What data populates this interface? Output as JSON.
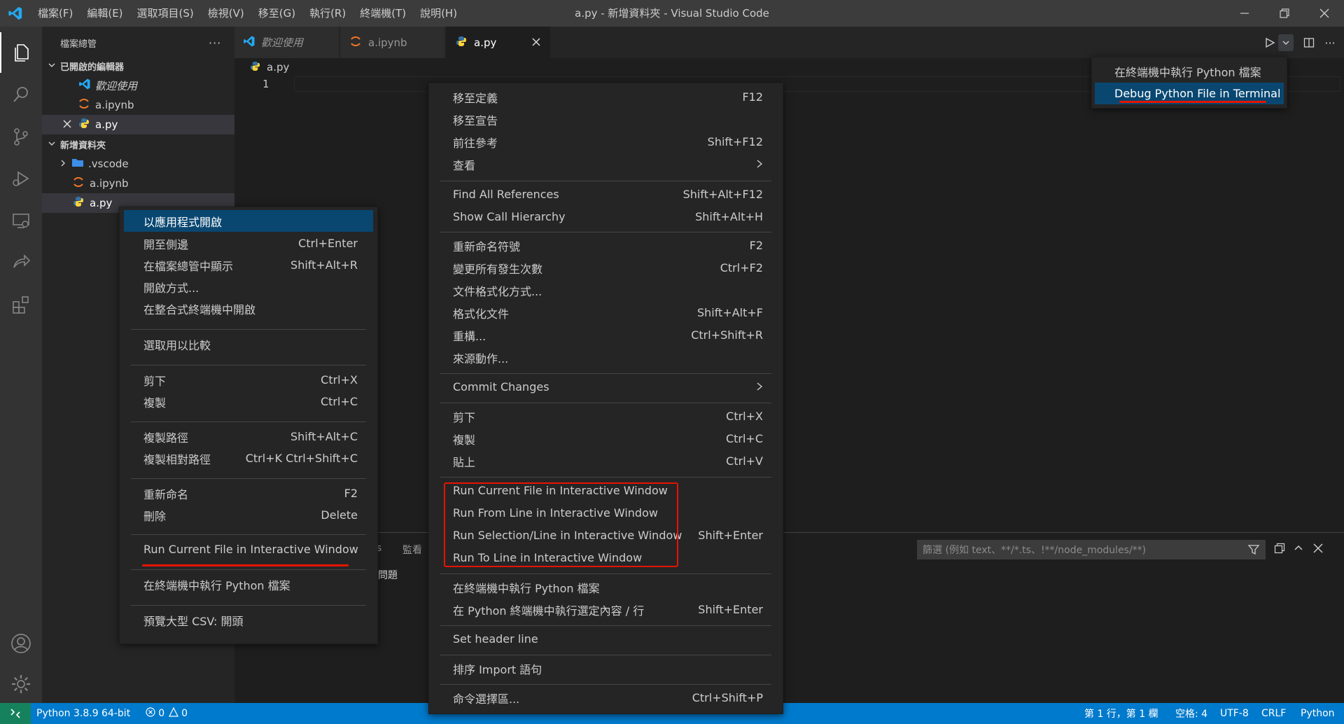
{
  "window": {
    "title": "a.py - 新增資料夾 - Visual Studio Code",
    "menu": [
      "檔案(F)",
      "編輯(E)",
      "選取項目(S)",
      "檢視(V)",
      "移至(G)",
      "執行(R)",
      "終端機(T)",
      "說明(H)"
    ]
  },
  "sidebar": {
    "header": "檔案總管",
    "open_editors_title": "已開啟的編輯器",
    "open_editors": [
      {
        "label": "歡迎使用",
        "icon": "vscode-icon"
      },
      {
        "label": "a.ipynb",
        "icon": "jupyter-icon"
      },
      {
        "label": "a.py",
        "icon": "python-icon"
      }
    ],
    "folder_title": "新增資料夾",
    "folder_items": [
      {
        "label": ".vscode",
        "icon": "folder-icon"
      },
      {
        "label": "a.ipynb",
        "icon": "jupyter-icon"
      },
      {
        "label": "a.py",
        "icon": "python-icon"
      }
    ]
  },
  "tabs": [
    {
      "label": "歡迎使用",
      "icon": "vscode-icon"
    },
    {
      "label": "a.ipynb",
      "icon": "jupyter-icon"
    },
    {
      "label": "a.py",
      "icon": "python-icon"
    }
  ],
  "editor": {
    "breadcrumb": "a.py",
    "line_number": "1"
  },
  "run_menu": {
    "items": [
      "在終端機中執行 Python 檔案",
      "Debug Python File in Terminal"
    ]
  },
  "explorer_menu": {
    "items": [
      {
        "label": "以應用程式開啟",
        "shortcut": ""
      },
      {
        "label": "開至側邊",
        "shortcut": "Ctrl+Enter"
      },
      {
        "label": "在檔案總管中顯示",
        "shortcut": "Shift+Alt+R"
      },
      {
        "label": "開啟方式...",
        "shortcut": ""
      },
      {
        "label": "在整合式終端機中開啟",
        "shortcut": ""
      },
      {
        "label": "選取用以比較",
        "shortcut": ""
      },
      {
        "label": "剪下",
        "shortcut": "Ctrl+X"
      },
      {
        "label": "複製",
        "shortcut": "Ctrl+C"
      },
      {
        "label": "複製路徑",
        "shortcut": "Shift+Alt+C"
      },
      {
        "label": "複製相對路徑",
        "shortcut": "Ctrl+K Ctrl+Shift+C"
      },
      {
        "label": "重新命名",
        "shortcut": "F2"
      },
      {
        "label": "刪除",
        "shortcut": "Delete"
      },
      {
        "label": "Run Current File in Interactive Window",
        "shortcut": ""
      },
      {
        "label": "在終端機中執行 Python 檔案",
        "shortcut": ""
      },
      {
        "label": "預覽大型 CSV: 開頭",
        "shortcut": ""
      }
    ]
  },
  "editor_menu": {
    "items": [
      {
        "label": "移至定義",
        "shortcut": "F12"
      },
      {
        "label": "移至宣告",
        "shortcut": ""
      },
      {
        "label": "前往參考",
        "shortcut": "Shift+F12"
      },
      {
        "label": "查看",
        "shortcut": "",
        "submenu": true
      },
      {
        "label": "Find All References",
        "shortcut": "Shift+Alt+F12"
      },
      {
        "label": "Show Call Hierarchy",
        "shortcut": "Shift+Alt+H"
      },
      {
        "label": "重新命名符號",
        "shortcut": "F2"
      },
      {
        "label": "變更所有發生次數",
        "shortcut": "Ctrl+F2"
      },
      {
        "label": "文件格式化方式...",
        "shortcut": ""
      },
      {
        "label": "格式化文件",
        "shortcut": "Shift+Alt+F"
      },
      {
        "label": "重構...",
        "shortcut": "Ctrl+Shift+R"
      },
      {
        "label": "來源動作...",
        "shortcut": ""
      },
      {
        "label": "Commit Changes",
        "shortcut": "",
        "submenu": true
      },
      {
        "label": "剪下",
        "shortcut": "Ctrl+X"
      },
      {
        "label": "複製",
        "shortcut": "Ctrl+C"
      },
      {
        "label": "貼上",
        "shortcut": "Ctrl+V"
      },
      {
        "label": "Run Current File in Interactive Window",
        "shortcut": ""
      },
      {
        "label": "Run From Line in Interactive Window",
        "shortcut": ""
      },
      {
        "label": "Run Selection/Line in Interactive Window",
        "shortcut": "Shift+Enter"
      },
      {
        "label": "Run To Line in Interactive Window",
        "shortcut": ""
      },
      {
        "label": "在終端機中執行 Python 檔案",
        "shortcut": ""
      },
      {
        "label": "在 Python 終端機中執行選定內容 / 行",
        "shortcut": "Shift+Enter"
      },
      {
        "label": "Set header line",
        "shortcut": ""
      },
      {
        "label": "排序 Import 語句",
        "shortcut": ""
      },
      {
        "label": "命令選擇區...",
        "shortcut": "Ctrl+Shift+P"
      }
    ]
  },
  "panel": {
    "tab_partial": "s",
    "tab_watch": "監看",
    "problems_label": "問題",
    "filter_placeholder": "篩選 (例如 text、**/*.ts、!**/node_modules/**)"
  },
  "statusbar": {
    "interpreter": "Python 3.8.9 64-bit",
    "errors": "0",
    "warnings": "0",
    "position": "第 1 行，第 1 欄",
    "indent": "空格: 4",
    "encoding": "UTF-8",
    "eol": "CRLF",
    "language": "Python"
  },
  "colors": {
    "accent": "#007acc",
    "highlight": "#094771",
    "annotation": "#e51400",
    "python_blue": "#3572a5",
    "python_yellow": "#ffd43b",
    "jupyter_orange": "#f37726"
  }
}
